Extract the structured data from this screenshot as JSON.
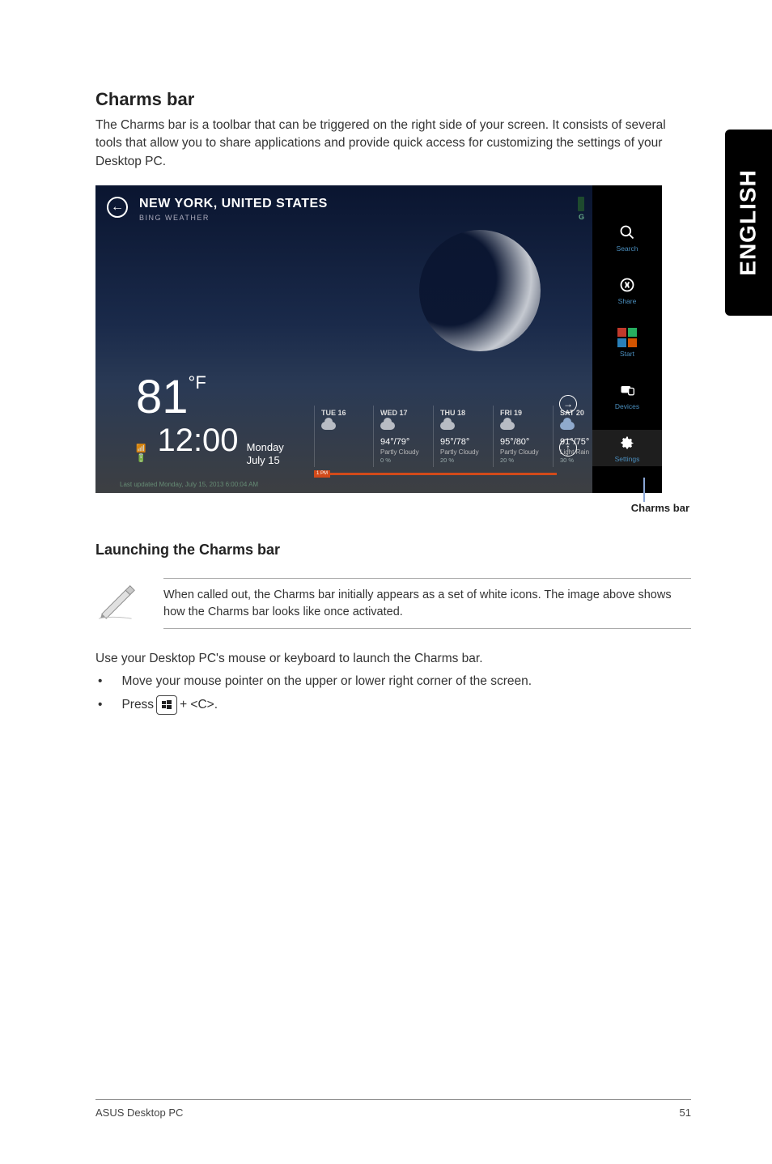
{
  "side_tab": "ENGLISH",
  "section": {
    "title": "Charms bar",
    "intro": "The Charms bar is a toolbar that can be triggered on the right side of your screen. It consists of several tools that allow you to share applications and provide quick access for customizing the settings of your Desktop PC."
  },
  "screenshot": {
    "back_symbol": "←",
    "title": "NEW YORK, UNITED STATES",
    "subtitle": "BING WEATHER",
    "temp_value": "81",
    "temp_unit": "°F",
    "time": "12:00",
    "day": "Monday",
    "date": "July 15",
    "forecast": [
      {
        "hdr": "TUE 16",
        "t": "",
        "cond": "",
        "pct": "",
        "icon": "cloud"
      },
      {
        "hdr": "WED 17",
        "t": "94°/79°",
        "cond": "Partly Cloudy",
        "pct": "0 %",
        "icon": "cloud"
      },
      {
        "hdr": "THU 18",
        "t": "95°/78°",
        "cond": "Partly Cloudy",
        "pct": "20 %",
        "icon": "cloud"
      },
      {
        "hdr": "FRI 19",
        "t": "95°/80°",
        "cond": "Partly Cloudy",
        "pct": "20 %",
        "icon": "cloud"
      },
      {
        "hdr": "SAT 20",
        "t": "91°/75°",
        "cond": "Light Rain",
        "pct": "30 %",
        "icon": "rain"
      }
    ],
    "updated": "Last updated Monday, July 15, 2013 6:00:04 AM",
    "pm_tab": "1 PM",
    "peek_letter": "G",
    "nav_right": "→",
    "nav_up": "↑"
  },
  "charms": [
    {
      "label": "Search",
      "icon": "search"
    },
    {
      "label": "Share",
      "icon": "share"
    },
    {
      "label": "Start",
      "icon": "start"
    },
    {
      "label": "Devices",
      "icon": "devices"
    },
    {
      "label": "Settings",
      "icon": "settings"
    }
  ],
  "charms_callout": "Charms bar",
  "subsection": {
    "title": "Launching the Charms bar",
    "note": "When called out, the Charms bar initially appears as a set of white icons. The image above shows how the Charms bar looks like once activated.",
    "body": "Use your Desktop PC's mouse or keyboard to launch the Charms bar.",
    "bullets": [
      "Move your mouse pointer on the upper or lower right corner of the screen.",
      {
        "prefix": "Press ",
        "suffix": " + <C>."
      }
    ]
  },
  "footer": {
    "left": "ASUS Desktop PC",
    "right": "51"
  }
}
